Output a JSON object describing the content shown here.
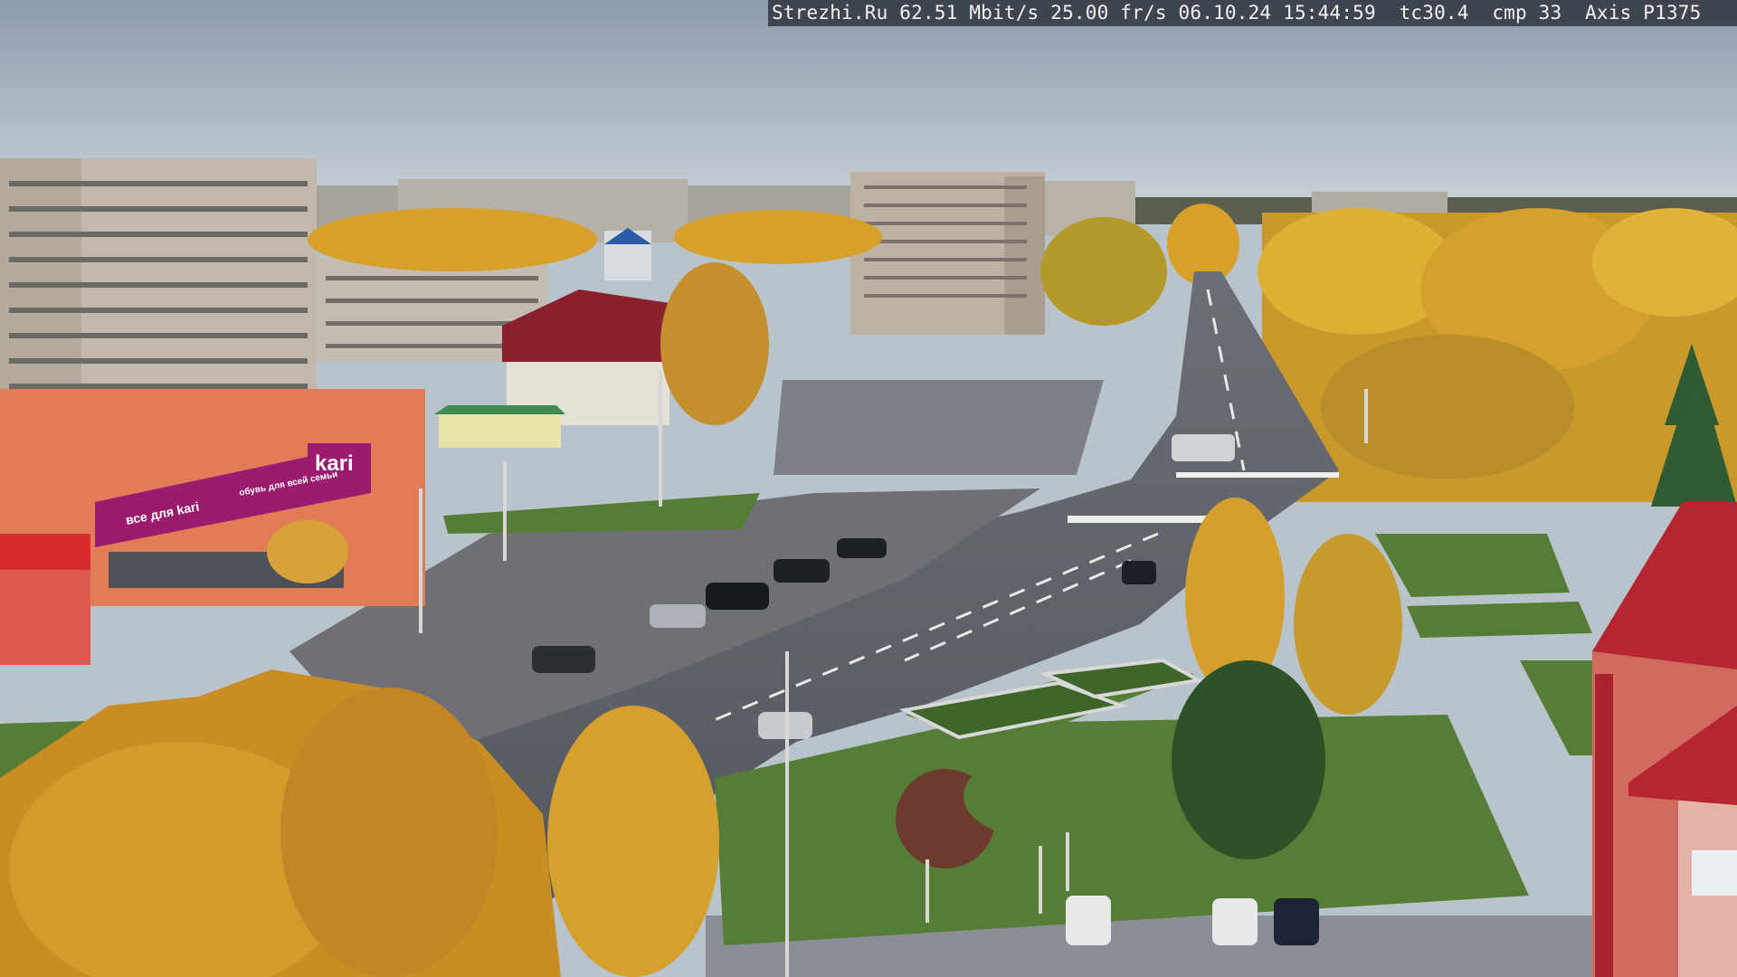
{
  "camera_overlay": {
    "site": "Strezhi.Ru",
    "bitrate": "62.51 Mbit/s",
    "framerate": "25.00 fr/s",
    "datetime": "06.10.24 15:44:59",
    "tc": "tc30.4",
    "cmp": "cmp 33",
    "model": "Axis P1375"
  },
  "storefront": {
    "sign": "kari",
    "banner": "все для kari",
    "banner2": "обувь для всей семьи"
  },
  "colors": {
    "sky_top": "#8f9eae",
    "sky_bottom": "#c6cfd6",
    "foliage": "#d9a325",
    "asphalt": "#5d6066",
    "grass": "#4f7a33",
    "brand_magenta": "#9b1b6e",
    "overlay_bg": "#2a2e35"
  }
}
